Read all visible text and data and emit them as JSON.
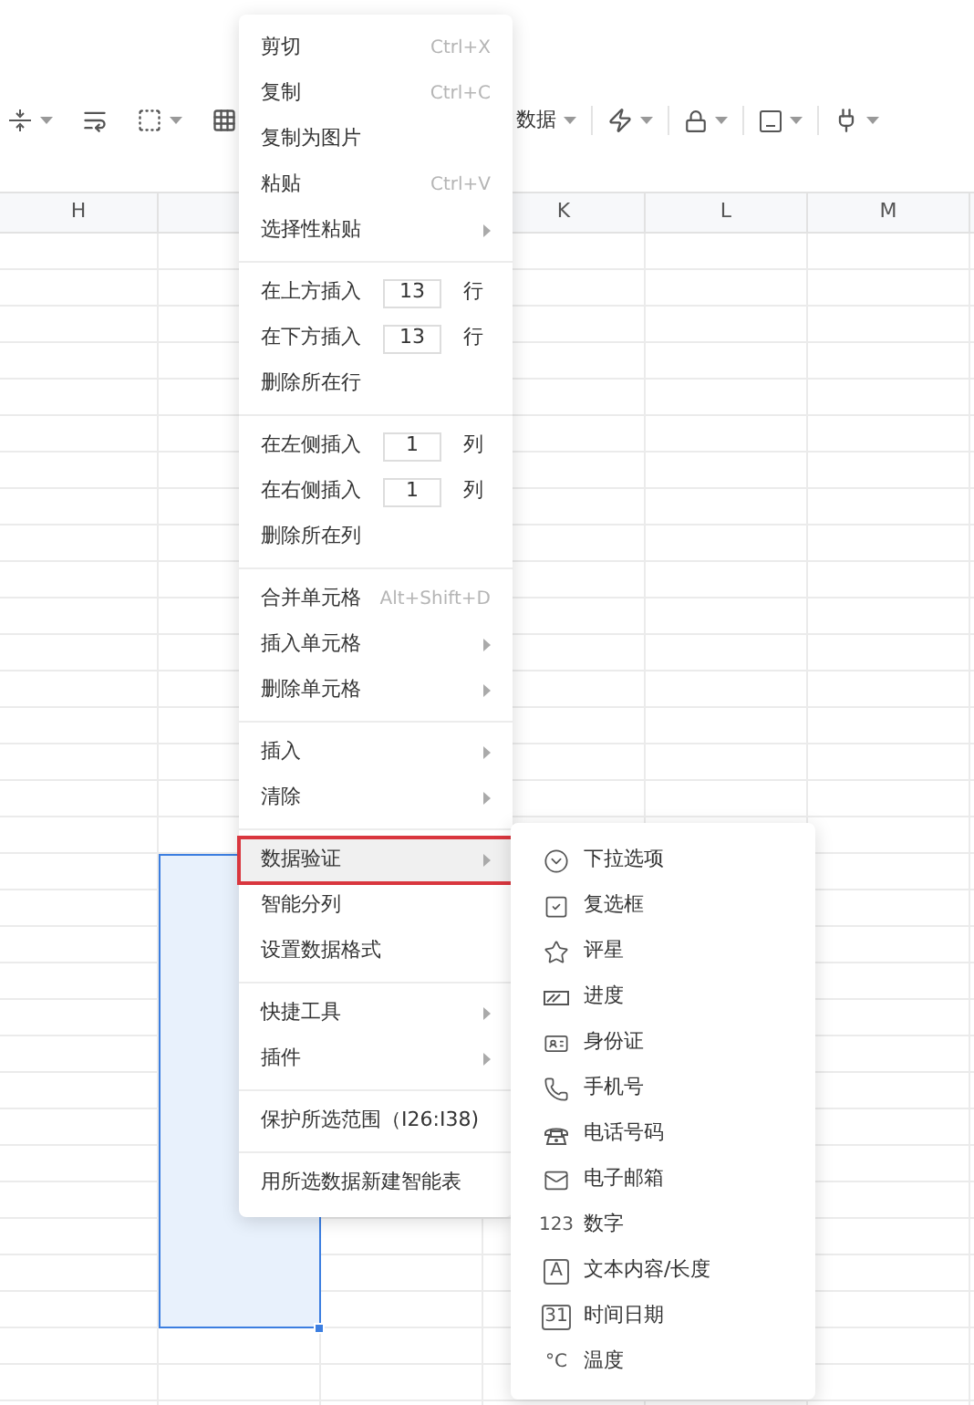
{
  "toolbar": {
    "data_button": "数据"
  },
  "columns": [
    {
      "label": "H"
    },
    {
      "label": "K"
    },
    {
      "label": "L"
    },
    {
      "label": "M"
    }
  ],
  "context_menu": {
    "groups": [
      {
        "items": [
          {
            "kind": "command",
            "label": "剪切",
            "shortcut": "Ctrl+X",
            "selected": false
          },
          {
            "kind": "command",
            "label": "复制",
            "shortcut": "Ctrl+C",
            "selected": false
          },
          {
            "kind": "command",
            "label": "复制为图片",
            "selected": false
          },
          {
            "kind": "command",
            "label": "粘贴",
            "shortcut": "Ctrl+V",
            "selected": false
          },
          {
            "kind": "submenu",
            "label": "选择性粘贴",
            "selected": false
          }
        ]
      },
      {
        "items": [
          {
            "kind": "insert",
            "label": "在上方插入",
            "value": "13",
            "unit": "行",
            "selected": false
          },
          {
            "kind": "insert",
            "label": "在下方插入",
            "value": "13",
            "unit": "行",
            "selected": false
          },
          {
            "kind": "command",
            "label": "删除所在行",
            "selected": false
          }
        ]
      },
      {
        "items": [
          {
            "kind": "insert",
            "label": "在左侧插入",
            "value": "1",
            "unit": "列",
            "selected": false
          },
          {
            "kind": "insert",
            "label": "在右侧插入",
            "value": "1",
            "unit": "列",
            "selected": false
          },
          {
            "kind": "command",
            "label": "删除所在列",
            "selected": false
          }
        ]
      },
      {
        "items": [
          {
            "kind": "command",
            "label": "合并单元格",
            "shortcut": "Alt+Shift+D",
            "selected": false
          },
          {
            "kind": "submenu",
            "label": "插入单元格",
            "selected": false
          },
          {
            "kind": "submenu",
            "label": "删除单元格",
            "selected": false
          }
        ]
      },
      {
        "items": [
          {
            "kind": "submenu",
            "label": "插入",
            "selected": false
          },
          {
            "kind": "submenu",
            "label": "清除",
            "selected": false
          }
        ]
      },
      {
        "items": [
          {
            "kind": "submenu",
            "label": "数据验证",
            "selected": true
          },
          {
            "kind": "command",
            "label": "智能分列",
            "selected": false
          },
          {
            "kind": "command",
            "label": "设置数据格式",
            "selected": false
          }
        ]
      },
      {
        "items": [
          {
            "kind": "submenu",
            "label": "快捷工具",
            "selected": false
          },
          {
            "kind": "submenu",
            "label": "插件",
            "selected": false
          }
        ]
      },
      {
        "items": [
          {
            "kind": "command",
            "label": "保护所选范围（I26:I38)",
            "selected": false
          }
        ]
      },
      {
        "items": [
          {
            "kind": "command",
            "label": "用所选数据新建智能表",
            "selected": false
          }
        ]
      }
    ]
  },
  "validation_submenu": {
    "items": [
      {
        "kind": "dropdown",
        "label": "下拉选项"
      },
      {
        "kind": "checkbox",
        "label": "复选框"
      },
      {
        "kind": "rating",
        "label": "评星"
      },
      {
        "kind": "progress",
        "label": "进度"
      },
      {
        "kind": "id_card",
        "label": "身份证"
      },
      {
        "kind": "mobile",
        "label": "手机号"
      },
      {
        "kind": "telephone",
        "label": "电话号码"
      },
      {
        "kind": "email",
        "label": "电子邮箱"
      },
      {
        "kind": "number",
        "glyph": "123",
        "label": "数字"
      },
      {
        "kind": "text",
        "glyph": "A",
        "label": "文本内容/长度"
      },
      {
        "kind": "date",
        "glyph": "31",
        "label": "时间日期"
      },
      {
        "kind": "temperature",
        "glyph": "°C",
        "label": "温度"
      }
    ]
  }
}
